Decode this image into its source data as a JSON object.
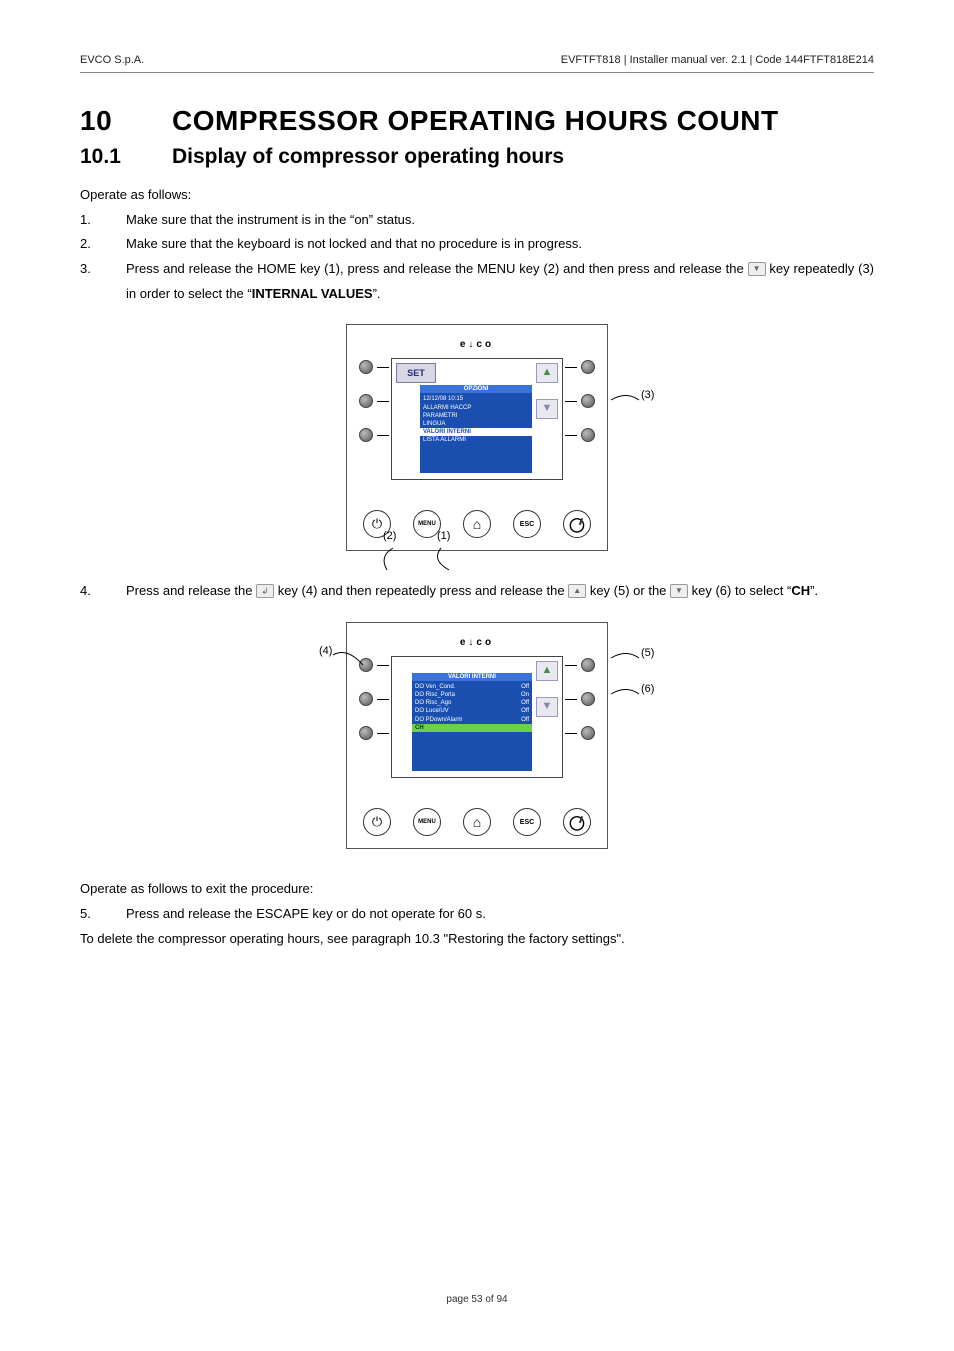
{
  "header": {
    "left": "EVCO S.p.A.",
    "right": "EVFTFT818 | Installer manual ver. 2.1 | Code 144FTFT818E214"
  },
  "chapter": {
    "num": "10",
    "title": "COMPRESSOR OPERATING HOURS COUNT"
  },
  "section": {
    "num": "10.1",
    "title": "Display of compressor operating hours"
  },
  "intro": "Operate as follows:",
  "steps": {
    "1": {
      "n": "1.",
      "t": "Make sure that the instrument is in the “on” status."
    },
    "2": {
      "n": "2.",
      "t": "Make sure that the keyboard is not locked and that no procedure is in progress."
    },
    "3": {
      "n": "3.",
      "pre": "Press and release the HOME key (1), press and release the MENU key (2) and then press and release the ",
      "post": " key repeatedly (3) in order to select the “",
      "kw": "INTERNAL VALUES",
      "end": "”."
    },
    "4": {
      "n": "4.",
      "pre": "Press and release the ",
      "mid1": " key (4) and then repeatedly press and release the ",
      "mid2": " key (5) or the ",
      "post": " key (6) to select “",
      "kw": "CH",
      "end": "”."
    },
    "5": {
      "n": "5.",
      "t": "Press and release the ESCAPE key or do not operate for 60 s."
    }
  },
  "exit_intro": "Operate as follows to exit the procedure:",
  "delete_note": "To delete the compressor operating hours, see paragraph 10.3 \"Restoring the factory settings\".",
  "fig1": {
    "brand": "e↓co",
    "set": "SET",
    "panel_title": "OPZIONI",
    "rows": [
      "12/12/08 10:15",
      "ALLARMI HACCP",
      "PARAMETRI",
      "LINGUA",
      "VALORI INTERNI",
      "LISTA ALLARMI"
    ],
    "menu_label": "MENU",
    "esc_label": "ESC",
    "call_1": "(1)",
    "call_2": "(2)",
    "call_3": "(3)"
  },
  "fig2": {
    "brand": "e↓co",
    "panel_title": "VALORI INTERNI",
    "rows": [
      {
        "l": "DO Ven_Cond.",
        "r": "Off"
      },
      {
        "l": "DO Risc_Porta",
        "r": "On"
      },
      {
        "l": "DO Risc_Ago",
        "r": "Off"
      },
      {
        "l": "DO Luce/UV",
        "r": "Off"
      },
      {
        "l": "DO PDown/Alarm",
        "r": "Off"
      },
      {
        "l": "CH",
        "r": ""
      }
    ],
    "menu_label": "MENU",
    "esc_label": "ESC",
    "call_4": "(4)",
    "call_5": "(5)",
    "call_6": "(6)"
  },
  "footer": "page 53 of 94"
}
